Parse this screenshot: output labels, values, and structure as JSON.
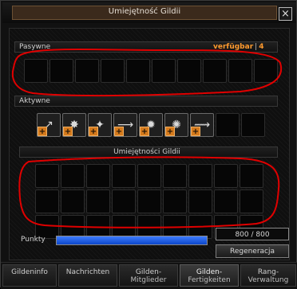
{
  "window": {
    "title": "Umiejętność Gildii",
    "close_symbol": "×"
  },
  "sections": {
    "pasywne_label": "Pasywne",
    "aktywne_label": "Aktywne",
    "skills_label": "Umiejętności Gildii"
  },
  "availability": {
    "label": "verfügbar",
    "separator": "|",
    "count": "4"
  },
  "points": {
    "label": "Punkty",
    "value_text": "800 / 800",
    "fill_fraction": 1.0
  },
  "buttons": {
    "regen_label": "Regeneracja"
  },
  "tabs": [
    {
      "line1": "Gildeninfo",
      "line2": ""
    },
    {
      "line1": "Nachrichten",
      "line2": ""
    },
    {
      "line1": "Gilden-",
      "line2": "Mitglieder"
    },
    {
      "line1": "Gilden-",
      "line2": "Fertigkeiten"
    },
    {
      "line1": "Rang-",
      "line2": "Verwaltung"
    }
  ],
  "active_skills": [
    {
      "icon": "sword-skill-icon",
      "glyph": "↗",
      "plus": "+"
    },
    {
      "icon": "burst-skill-icon",
      "glyph": "✸",
      "plus": "+"
    },
    {
      "icon": "spark-skill-icon",
      "glyph": "✦",
      "plus": "+"
    },
    {
      "icon": "beam-skill-icon",
      "glyph": "⟶",
      "plus": "+"
    },
    {
      "icon": "explosion-skill-icon",
      "glyph": "✹",
      "plus": "+"
    },
    {
      "icon": "shield-skill-icon",
      "glyph": "✺",
      "plus": "+"
    },
    {
      "icon": "claw-skill-icon",
      "glyph": "⟿",
      "plus": "+"
    }
  ],
  "colors": {
    "accent_orange": "#ff9a2e",
    "annotation_red": "#e00000",
    "points_blue": "#2f6dff"
  }
}
